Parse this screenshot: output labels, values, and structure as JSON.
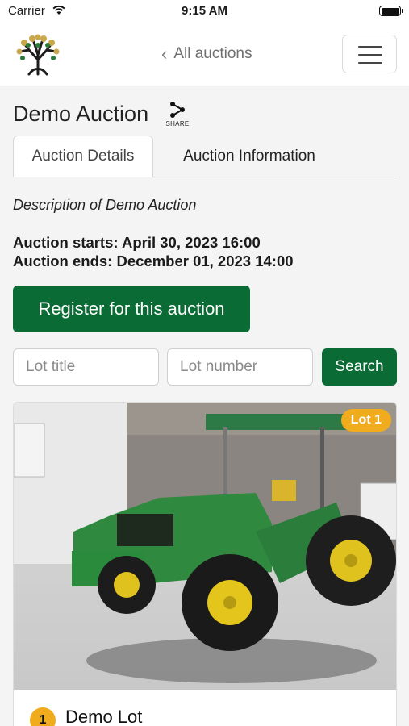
{
  "status_bar": {
    "carrier": "Carrier",
    "time": "9:15 AM"
  },
  "nav": {
    "back_label": "All auctions",
    "menu_icon": "hamburger-menu-icon"
  },
  "auction": {
    "title": "Demo Auction",
    "share_label": "SHARE",
    "description": "Description of Demo Auction",
    "starts": "Auction starts: April 30, 2023 16:00",
    "ends": "Auction ends: December 01, 2023 14:00"
  },
  "tabs": [
    {
      "label": "Auction Details",
      "active": true
    },
    {
      "label": "Auction Information",
      "active": false
    }
  ],
  "actions": {
    "register_label": "Register for this auction",
    "search_label": "Search"
  },
  "search": {
    "lot_title_placeholder": "Lot title",
    "lot_number_placeholder": "Lot number"
  },
  "lots": [
    {
      "badge": "Lot 1",
      "number": "1",
      "title": "Demo Lot"
    }
  ],
  "colors": {
    "primary": "#0b6b35",
    "badge": "#f0ac1c"
  }
}
